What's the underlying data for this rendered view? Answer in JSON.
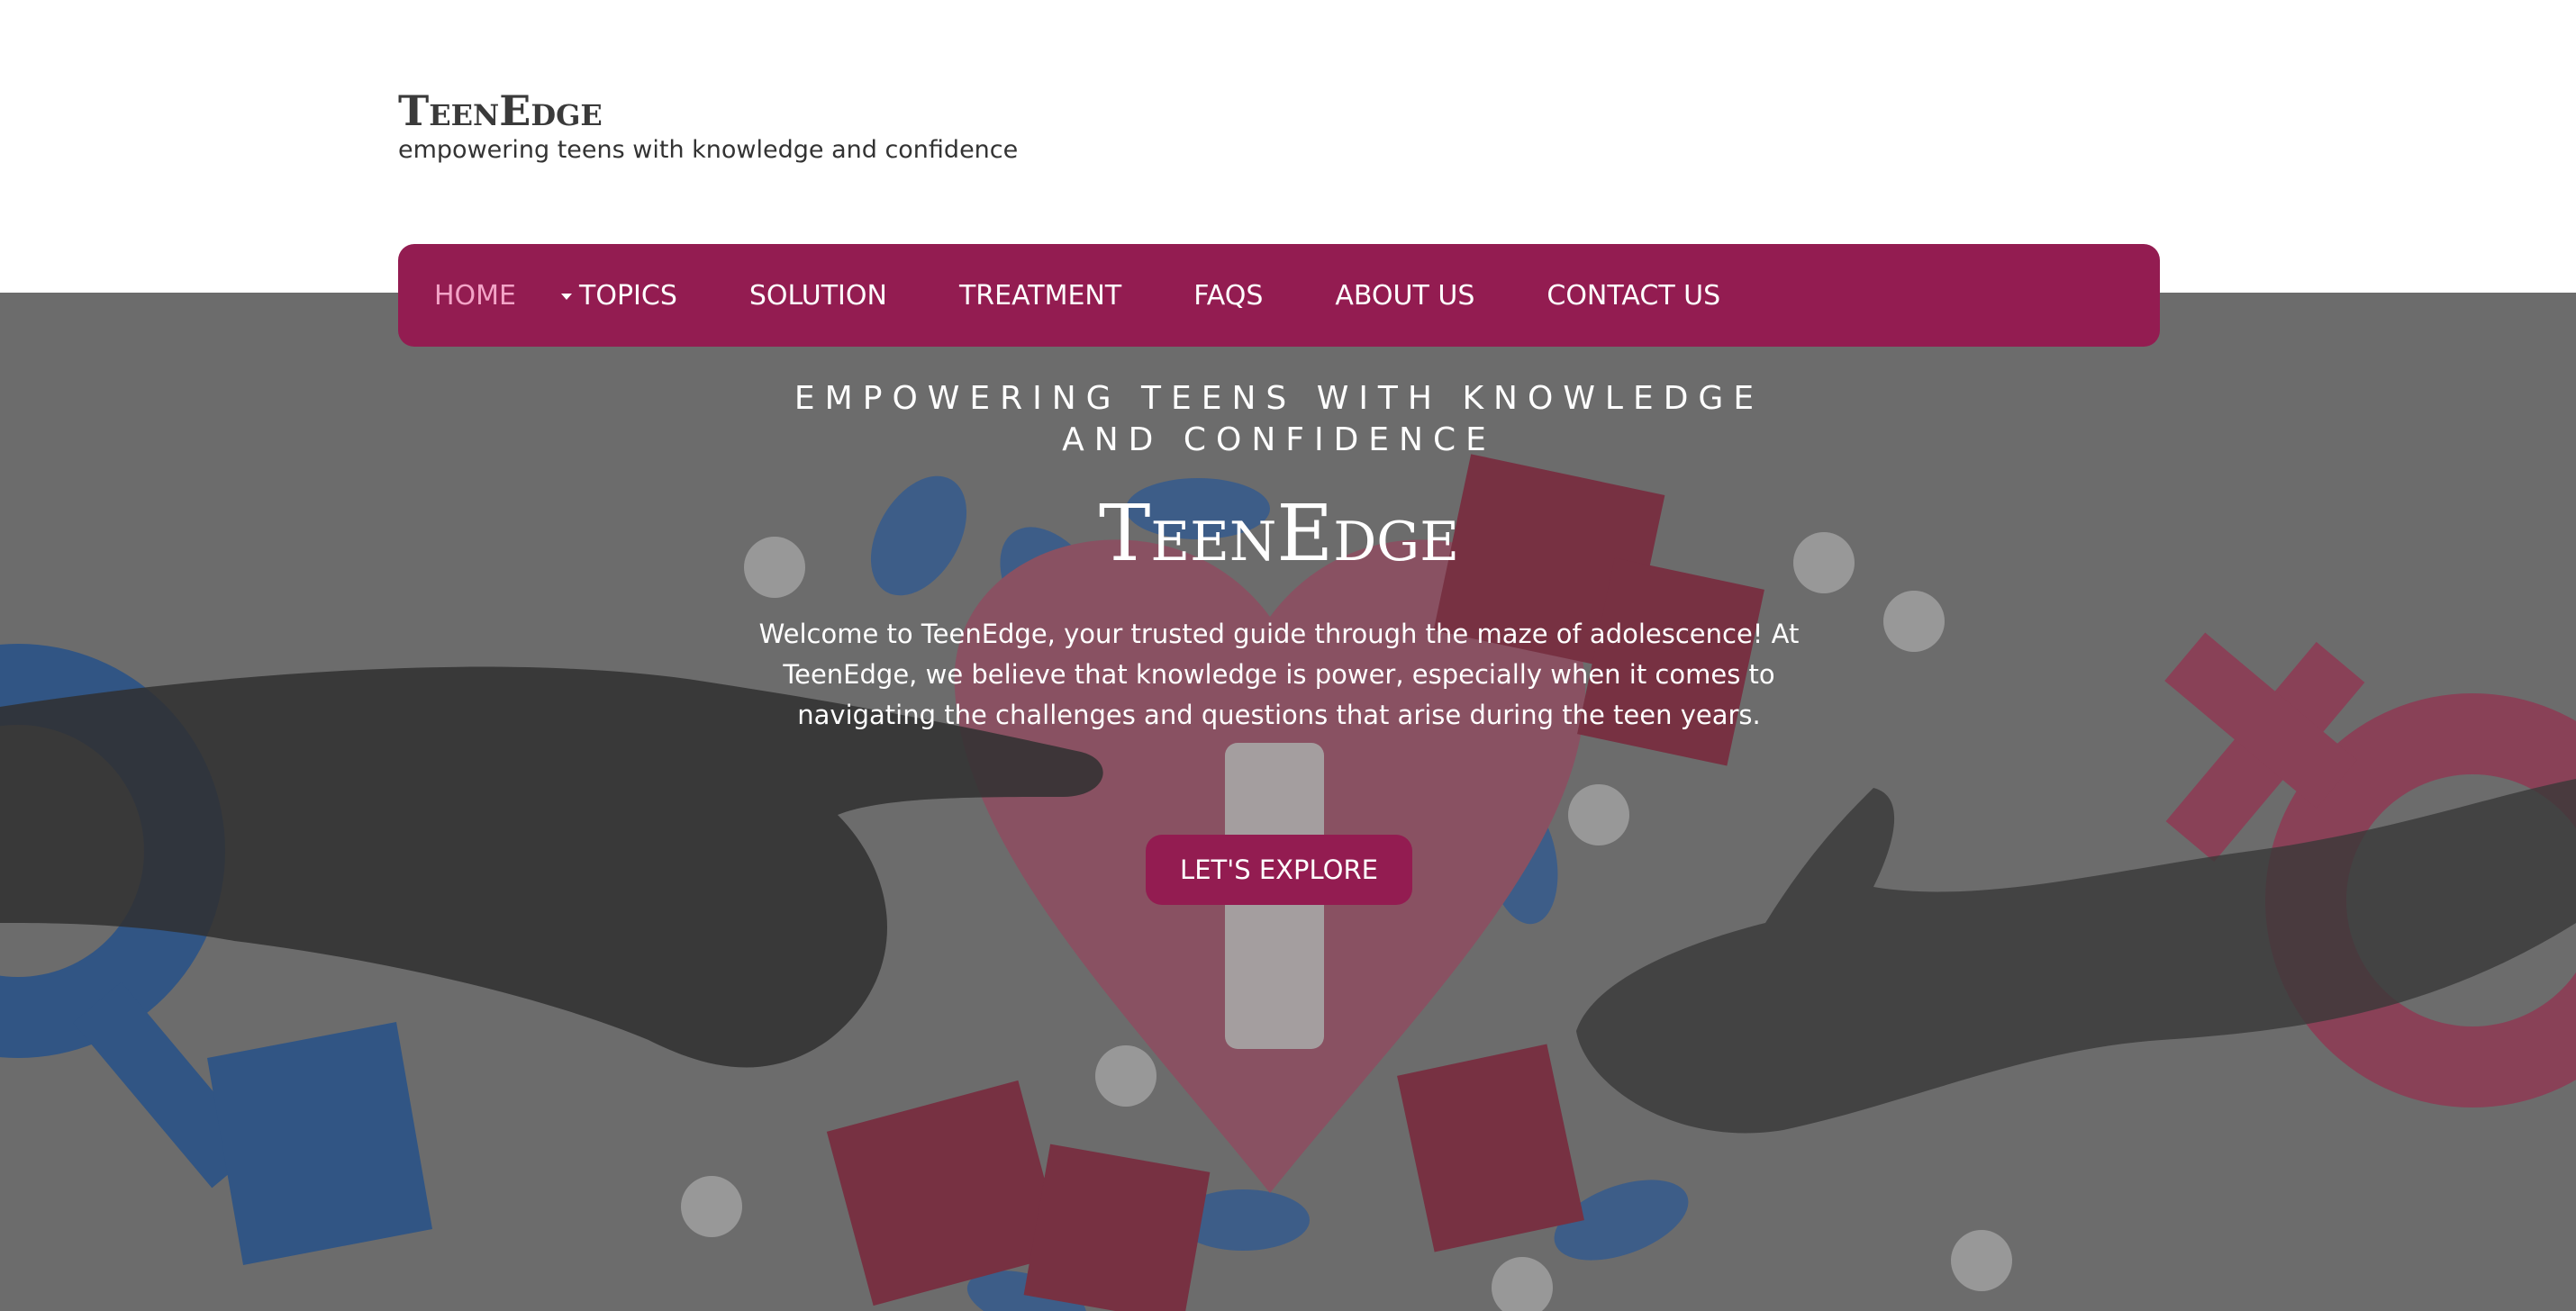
{
  "header": {
    "logo": "TeenEdge",
    "tagline": "empowering teens with knowledge and confidence"
  },
  "nav": {
    "items": [
      {
        "label": "HOME",
        "active": true
      },
      {
        "label": "TOPICS",
        "has_dropdown": true
      },
      {
        "label": "SOLUTION"
      },
      {
        "label": "TREATMENT"
      },
      {
        "label": "FAQS"
      },
      {
        "label": "ABOUT US"
      },
      {
        "label": "CONTACT US"
      }
    ]
  },
  "hero": {
    "eyebrow": "EMPOWERING TEENS WITH KNOWLEDGE AND CONFIDENCE",
    "title": "TeenEdge",
    "text": "Welcome to TeenEdge, your trusted guide through the maze of adolescence! At TeenEdge, we believe that knowledge is power, especially when it comes to navigating the challenges and questions that arise during the teen years.",
    "cta_label": "LET'S EXPLORE",
    "background_image_icons": [
      "male-symbol-icon",
      "female-symbol-icon",
      "heart-icon",
      "condom-packet-icon",
      "pill-icon",
      "reaching-hands"
    ]
  },
  "colors": {
    "brand": "#931c51",
    "active_nav": "#f3a4c7",
    "header_text": "#3a3a3a"
  }
}
